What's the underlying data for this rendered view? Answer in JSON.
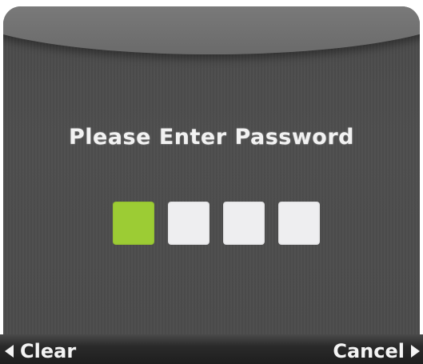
{
  "dialog": {
    "title": "Please Enter Password",
    "pin": {
      "length": 4,
      "current_index": 0,
      "active_color": "#9ccc34",
      "empty_color": "#eeeef0"
    }
  },
  "softkeys": {
    "left": {
      "label": "Clear",
      "icon": "arrow-left-icon"
    },
    "right": {
      "label": "Cancel",
      "icon": "arrow-right-icon"
    }
  }
}
